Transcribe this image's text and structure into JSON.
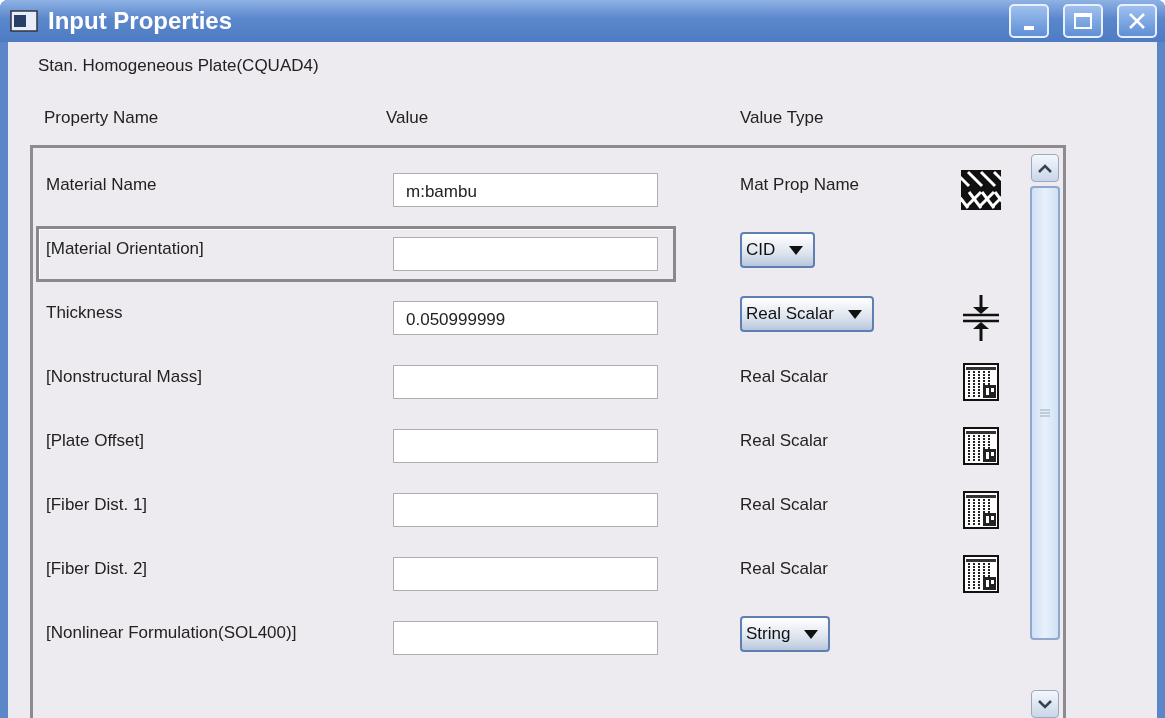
{
  "window": {
    "title": "Input Properties"
  },
  "subtitle": "Stan. Homogeneous Plate(CQUAD4)",
  "columns": [
    "Property Name",
    "Value",
    "Value Type"
  ],
  "rows": [
    {
      "label": "Material Name",
      "value": "m:bambu",
      "kind": "label",
      "value_type": "Mat Prop Name",
      "selected": false
    },
    {
      "label": "[Material Orientation]",
      "kind": "dropdown",
      "value_type": "CID",
      "selected": true
    },
    {
      "label": "Thickness",
      "value": "0.050999999",
      "kind": "dropdown",
      "value_type": "Real Scalar",
      "selected": false
    },
    {
      "label": "[Nonstructural Mass]",
      "kind": "label",
      "value_type": "Real Scalar",
      "selected": false
    },
    {
      "label": "[Plate Offset]",
      "kind": "label",
      "value_type": "Real Scalar",
      "selected": false
    },
    {
      "label": "[Fiber Dist. 1]",
      "kind": "label",
      "value_type": "Real Scalar",
      "selected": false
    },
    {
      "label": "[Fiber Dist. 2]",
      "kind": "label",
      "value_type": "Real Scalar",
      "selected": false
    },
    {
      "label": "[Nonlinear Formulation(SOL400)]",
      "kind": "dropdown",
      "value_type": "String",
      "selected": false
    }
  ]
}
